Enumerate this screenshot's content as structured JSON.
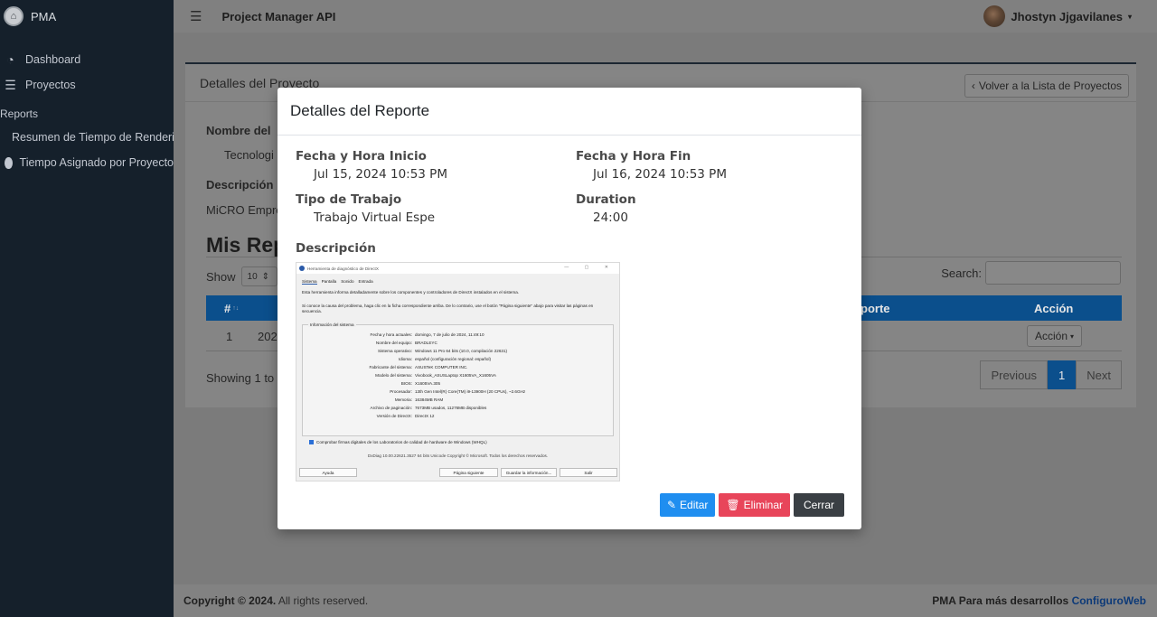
{
  "sidebar": {
    "brand": "PMA",
    "items": [
      {
        "label": "Dashboard",
        "icon": "dashboard-icon"
      },
      {
        "label": "Proyectos",
        "icon": "list-icon"
      }
    ],
    "section_header": "Reports",
    "report_items": [
      {
        "label": "Resumen de Tiempo de Renderi"
      },
      {
        "label": "Tiempo Asignado por Proyecto"
      }
    ]
  },
  "topbar": {
    "title": "Project Manager API",
    "user": "Jhostyn Jjgavilanes"
  },
  "project": {
    "header": "Detalles del Proyecto",
    "back_button": "Volver a la Lista de Proyectos",
    "name_label": "Nombre del",
    "name_value": "Tecnologi",
    "description_label": "Descripción",
    "description_value": "MiCRO Empre",
    "reports_heading": "Mis Rep",
    "show_label": "Show",
    "show_value": "10",
    "search_label": "Search:",
    "table": {
      "col_hash": "#",
      "col_report": "porte",
      "col_action": "Acción",
      "row_index": "1",
      "row_date": "202",
      "row_action_button": "Acción"
    },
    "showing_text": "Showing 1 to",
    "pagination": {
      "previous": "Previous",
      "current": "1",
      "next": "Next"
    }
  },
  "footer": {
    "copyright_bold": "Copyright © 2024.",
    "copyright_rest": "All rights reserved.",
    "right_text": "PMA Para más desarrollos",
    "right_link": "ConfiguroWeb"
  },
  "modal": {
    "title": "Detalles del Reporte",
    "start_label": "Fecha y Hora Inicio",
    "start_value": "Jul 15, 2024 10:53 PM",
    "end_label": "Fecha y Hora Fin",
    "end_value": "Jul 16, 2024 10:53 PM",
    "work_type_label": "Tipo de Trabajo",
    "work_type_value": "Trabajo Virtual Espe",
    "duration_label": "Duration",
    "duration_value": "24:00",
    "description_label": "Descripción",
    "buttons": {
      "edit": "Editar",
      "delete": "Eliminar",
      "close": "Cerrar"
    }
  },
  "attachment": {
    "window_title": "Herramienta de diagnóstico de DirectX",
    "tabs": [
      "Sistema",
      "Pantalla",
      "Sonido",
      "Entrada"
    ],
    "intro": "Esta herramienta informa detalladamente sobre los componentes y controladores de DirectX instalados en el sistema.",
    "intro2": "Si conoce la causa del problema, haga clic en la ficha correspondiente arriba. De lo contrario, use el botón \"Página siguiente\" abajo para visitar las páginas en secuencia.",
    "group_title": "Información del sistema",
    "rows": [
      {
        "k": "Fecha y hora actuales:",
        "v": "domingo, 7 de julio de 2024, 11:49:10"
      },
      {
        "k": "Nombre del equipo:",
        "v": "BRADLEYC"
      },
      {
        "k": "Sistema operativo:",
        "v": "Windows 11 Pro 64 bits (10.0, compilación 22631)"
      },
      {
        "k": "Idioma:",
        "v": "español (configuración regional: español)"
      },
      {
        "k": "Fabricante del sistema:",
        "v": "ASUSTeK COMPUTER INC."
      },
      {
        "k": "Modelo del sistema:",
        "v": "Vivobook_ASUSLaptop X1605VA_X1605VA"
      },
      {
        "k": "BIOS:",
        "v": "X1605VA.305"
      },
      {
        "k": "Procesador:",
        "v": "13th Gen Intel(R) Core(TM) i9-13900H (20 CPUs), ~2.6GHz"
      },
      {
        "k": "Memoria:",
        "v": "16384MB RAM"
      },
      {
        "k": "Archivo de paginación:",
        "v": "7673MB usados, 11276MB disponibles"
      },
      {
        "k": "Versión de DirectX:",
        "v": "DirectX 12"
      }
    ],
    "checkbox": "Comprobar firmas digitales de los Laboratorios de calidad de hardware de Windows (WHQL)",
    "footer": "DxDiag 10.00.22621.3527 64 bits Unicode  Copyright © Microsoft. Todos los derechos reservados.",
    "buttons": [
      "Ayuda",
      "Página siguiente",
      "Guardar la información...",
      "Salir"
    ]
  }
}
